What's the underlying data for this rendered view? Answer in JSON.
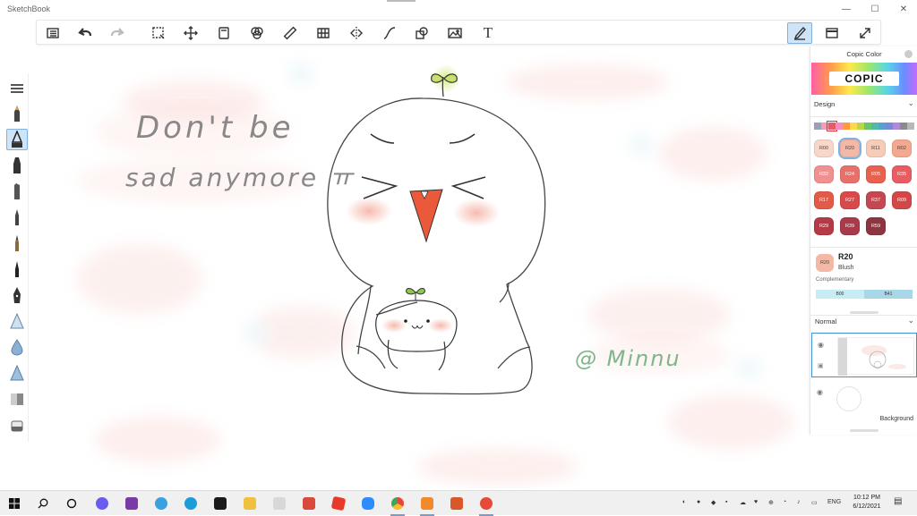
{
  "window": {
    "title": "SketchBook",
    "minimize_glyph": "—",
    "maximize_glyph": "☐",
    "close_glyph": "✕"
  },
  "toolbar": {
    "text_tool_label": "T",
    "items": [
      "list-icon",
      "undo-icon",
      "redo-icon",
      "select-icon",
      "transform-icon",
      "layer-icon",
      "color-icon",
      "ruler-icon",
      "perspective-icon",
      "symmetry-icon",
      "curve-icon",
      "shapes-icon",
      "image-icon",
      "text-icon",
      "brush-panel-icon",
      "window-icon",
      "fullscreen-icon"
    ]
  },
  "canvas": {
    "text_line1": "Don't be",
    "text_line2": "sad anymore ㅠ",
    "signature": "@ Minnu"
  },
  "copic_panel": {
    "title": "Copic Color",
    "logo": "COPIC",
    "set_name": "Design",
    "strip_colors": [
      "#9aa0b8",
      "#f0a0b0",
      "#e65a6a",
      "#f28ec0",
      "#ff9a3c",
      "#ffd84a",
      "#b8d84a",
      "#6ac66a",
      "#52b8a8",
      "#5aa0d6",
      "#7a88d6",
      "#b08ad8",
      "#8a8a8a",
      "#b8b8b8"
    ],
    "swatches": [
      {
        "code": "R00",
        "color": "#f8d6c8",
        "light": true
      },
      {
        "code": "R20",
        "color": "#f4b8a6",
        "light": true,
        "selected": true
      },
      {
        "code": "R11",
        "color": "#f6cbb8",
        "light": true
      },
      {
        "code": "R02",
        "color": "#f4a890",
        "light": true
      },
      {
        "code": "R32",
        "color": "#f09090",
        "light": false
      },
      {
        "code": "R24",
        "color": "#e8706a",
        "light": false
      },
      {
        "code": "R05",
        "color": "#e8604e",
        "light": false
      },
      {
        "code": "R35",
        "color": "#e85c62",
        "light": false
      },
      {
        "code": "R17",
        "color": "#e25a48",
        "light": false
      },
      {
        "code": "R27",
        "color": "#d84a4a",
        "light": false
      },
      {
        "code": "R37",
        "color": "#c44852",
        "light": false
      },
      {
        "code": "R09",
        "color": "#d24848",
        "light": false
      },
      {
        "code": "R29",
        "color": "#b63a46",
        "light": false
      },
      {
        "code": "R39",
        "color": "#a83a4a",
        "light": false
      },
      {
        "code": "R59",
        "color": "#8c3642",
        "light": false
      }
    ],
    "current": {
      "code": "R20",
      "name": "Blush",
      "color": "#f4b8a6"
    },
    "complementary_label": "Complementary",
    "complementary": [
      {
        "code": "B00",
        "color": "#c8ecf4"
      },
      {
        "code": "B41",
        "color": "#a8d8e8"
      }
    ]
  },
  "layers": {
    "blend_mode": "Normal",
    "items": [
      {
        "name": "",
        "selected": true
      },
      {
        "name": "Background",
        "selected": false
      }
    ]
  },
  "taskbar": {
    "language": "ENG",
    "time": "10:12 PM",
    "date": "6/12/2021"
  }
}
